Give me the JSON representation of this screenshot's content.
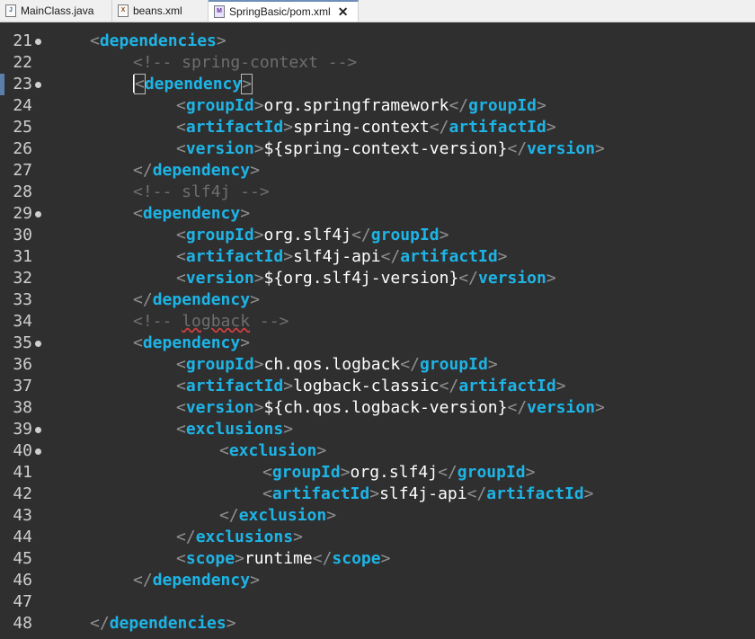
{
  "tabs": [
    {
      "label": "MainClass.java",
      "icon": "java-file-icon"
    },
    {
      "label": "beans.xml",
      "icon": "xml-file-icon"
    },
    {
      "label": "SpringBasic/pom.xml",
      "icon": "maven-pom-icon",
      "active": true
    }
  ],
  "lines": [
    {
      "n": "21",
      "fold": true,
      "indent": 1,
      "kind": "open",
      "tag": "dependencies"
    },
    {
      "n": "22",
      "fold": false,
      "indent": 2,
      "kind": "comment",
      "text": "<!-- spring-context -->"
    },
    {
      "n": "23",
      "fold": true,
      "indent": 2,
      "kind": "open",
      "tag": "dependency",
      "cursor": true
    },
    {
      "n": "24",
      "fold": false,
      "indent": 3,
      "kind": "elem",
      "tag": "groupId",
      "value": "org.springframework"
    },
    {
      "n": "25",
      "fold": false,
      "indent": 3,
      "kind": "elem",
      "tag": "artifactId",
      "value": "spring-context"
    },
    {
      "n": "26",
      "fold": false,
      "indent": 3,
      "kind": "elem",
      "tag": "version",
      "value": "${spring-context-version}"
    },
    {
      "n": "27",
      "fold": false,
      "indent": 2,
      "kind": "close",
      "tag": "dependency"
    },
    {
      "n": "28",
      "fold": false,
      "indent": 2,
      "kind": "comment",
      "text": "<!-- slf4j -->"
    },
    {
      "n": "29",
      "fold": true,
      "indent": 2,
      "kind": "open",
      "tag": "dependency"
    },
    {
      "n": "30",
      "fold": false,
      "indent": 3,
      "kind": "elem",
      "tag": "groupId",
      "value": "org.slf4j"
    },
    {
      "n": "31",
      "fold": false,
      "indent": 3,
      "kind": "elem",
      "tag": "artifactId",
      "value": "slf4j-api"
    },
    {
      "n": "32",
      "fold": false,
      "indent": 3,
      "kind": "elem",
      "tag": "version",
      "value": "${org.slf4j-version}"
    },
    {
      "n": "33",
      "fold": false,
      "indent": 2,
      "kind": "close",
      "tag": "dependency"
    },
    {
      "n": "34",
      "fold": false,
      "indent": 2,
      "kind": "comment",
      "text": "<!-- logback -->",
      "squiggle": "logback"
    },
    {
      "n": "35",
      "fold": true,
      "indent": 2,
      "kind": "open",
      "tag": "dependency"
    },
    {
      "n": "36",
      "fold": false,
      "indent": 3,
      "kind": "elem",
      "tag": "groupId",
      "value": "ch.qos.logback"
    },
    {
      "n": "37",
      "fold": false,
      "indent": 3,
      "kind": "elem",
      "tag": "artifactId",
      "value": "logback-classic"
    },
    {
      "n": "38",
      "fold": false,
      "indent": 3,
      "kind": "elem",
      "tag": "version",
      "value": "${ch.qos.logback-version}"
    },
    {
      "n": "39",
      "fold": true,
      "indent": 3,
      "kind": "open",
      "tag": "exclusions"
    },
    {
      "n": "40",
      "fold": true,
      "indent": 4,
      "kind": "open",
      "tag": "exclusion"
    },
    {
      "n": "41",
      "fold": false,
      "indent": 5,
      "kind": "elem",
      "tag": "groupId",
      "value": "org.slf4j"
    },
    {
      "n": "42",
      "fold": false,
      "indent": 5,
      "kind": "elem",
      "tag": "artifactId",
      "value": "slf4j-api"
    },
    {
      "n": "43",
      "fold": false,
      "indent": 4,
      "kind": "close",
      "tag": "exclusion"
    },
    {
      "n": "44",
      "fold": false,
      "indent": 3,
      "kind": "close",
      "tag": "exclusions"
    },
    {
      "n": "45",
      "fold": false,
      "indent": 3,
      "kind": "elem",
      "tag": "scope",
      "value": "runtime"
    },
    {
      "n": "46",
      "fold": false,
      "indent": 2,
      "kind": "close",
      "tag": "dependency"
    },
    {
      "n": "47",
      "fold": false,
      "indent": 0,
      "kind": "blank"
    },
    {
      "n": "48",
      "fold": false,
      "indent": 1,
      "kind": "close",
      "tag": "dependencies"
    }
  ],
  "colors": {
    "background": "#2f2f2f",
    "tag": "#1eb4e6",
    "bracket": "#909090",
    "text": "#ffffff",
    "comment": "#6e6e6e",
    "line_number": "#cfcfcf"
  }
}
